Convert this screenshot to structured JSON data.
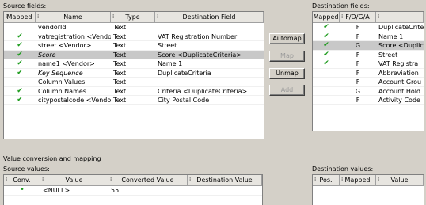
{
  "source_fields": {
    "label": "Source fields:",
    "headers": [
      "Mapped",
      "Name",
      "Type",
      "Destination Field"
    ],
    "rows": [
      {
        "mapped": false,
        "name": "vendorId",
        "type": "Text",
        "dest": "",
        "italic": false,
        "selected": false
      },
      {
        "mapped": true,
        "name": "vatregistration <Vendor>",
        "type": "Text",
        "dest": "VAT Registration Number",
        "italic": false,
        "selected": false
      },
      {
        "mapped": true,
        "name": "street <Vendor>",
        "type": "Text",
        "dest": "Street",
        "italic": false,
        "selected": false
      },
      {
        "mapped": true,
        "name": "Score",
        "type": "Text",
        "dest": "Score <DuplicateCriteria>",
        "italic": true,
        "selected": true
      },
      {
        "mapped": true,
        "name": "name1 <Vendor>",
        "type": "Text",
        "dest": "Name 1",
        "italic": false,
        "selected": false
      },
      {
        "mapped": true,
        "name": "Key Sequence",
        "type": "Text",
        "dest": "DuplicateCriteria",
        "italic": true,
        "selected": false
      },
      {
        "mapped": false,
        "name": "Column Values",
        "type": "Text",
        "dest": "",
        "italic": false,
        "selected": false
      },
      {
        "mapped": true,
        "name": "Column Names",
        "type": "Text",
        "dest": "Criteria <DuplicateCriteria>",
        "italic": false,
        "selected": false
      },
      {
        "mapped": true,
        "name": "citypostalcode <Vendor>",
        "type": "Text",
        "dest": "City Postal Code",
        "italic": false,
        "selected": false
      }
    ]
  },
  "buttons": {
    "automap": "Automap",
    "map": "Map",
    "unmap": "Unmap",
    "add": "Add"
  },
  "destination_fields": {
    "label": "Destination fields:",
    "headers": [
      "Mapped",
      "F/D/G/A",
      ""
    ],
    "rows": [
      {
        "mapped": true,
        "code": "F",
        "name": "DuplicateCrite",
        "selected": false
      },
      {
        "mapped": true,
        "code": "F",
        "name": "Name 1",
        "selected": false
      },
      {
        "mapped": true,
        "code": "G",
        "name": "Score <Duplic",
        "selected": true
      },
      {
        "mapped": true,
        "code": "F",
        "name": "Street",
        "selected": false
      },
      {
        "mapped": true,
        "code": "F",
        "name": "VAT Registra",
        "selected": false
      },
      {
        "mapped": false,
        "code": "F",
        "name": "Abbreviation",
        "selected": false
      },
      {
        "mapped": false,
        "code": "F",
        "name": "Account Grou",
        "selected": false
      },
      {
        "mapped": false,
        "code": "G",
        "name": "Account Hold",
        "selected": false
      },
      {
        "mapped": false,
        "code": "F",
        "name": "Activity Code",
        "selected": false
      }
    ]
  },
  "value_section": {
    "title": "Value conversion and mapping",
    "source_label": "Source values:",
    "source_headers": [
      "Conv.",
      "Value",
      "Converted Value",
      "Destination Value"
    ],
    "source_rows": [
      {
        "conv": "•",
        "value": "<NULL>",
        "converted": "55",
        "destination": ""
      }
    ],
    "dest_label": "Destination values:",
    "dest_headers": [
      "Pos.",
      "Mapped",
      "Value"
    ]
  },
  "colors": {
    "check": "#1a9a1a",
    "selected_row": "#c8c8c8",
    "window": "#d4d0c8"
  }
}
